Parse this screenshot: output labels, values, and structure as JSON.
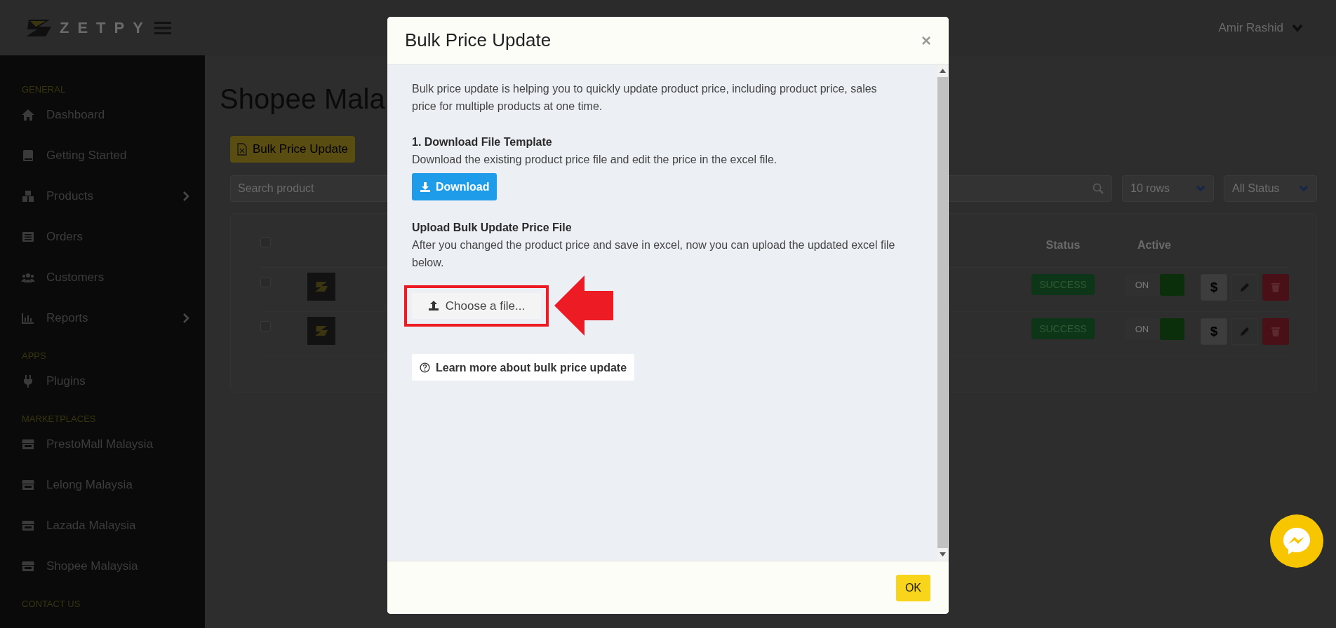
{
  "header": {
    "logo": "ZETPY",
    "user": "Amir Rashid"
  },
  "sidebar": {
    "sections": [
      {
        "label": "GENERAL",
        "items": [
          {
            "label": "Dashboard",
            "expandable": false
          },
          {
            "label": "Getting Started",
            "expandable": false
          },
          {
            "label": "Products",
            "expandable": true
          },
          {
            "label": "Orders",
            "expandable": false
          },
          {
            "label": "Customers",
            "expandable": false
          },
          {
            "label": "Reports",
            "expandable": true
          }
        ]
      },
      {
        "label": "APPS",
        "items": [
          {
            "label": "Plugins",
            "expandable": false
          }
        ]
      },
      {
        "label": "MARKETPLACES",
        "items": [
          {
            "label": "PrestoMall Malaysia",
            "expandable": false
          },
          {
            "label": "Lelong Malaysia",
            "expandable": false
          },
          {
            "label": "Lazada Malaysia",
            "expandable": false
          },
          {
            "label": "Shopee Malaysia",
            "expandable": false
          }
        ]
      },
      {
        "label": "CONTACT US"
      }
    ]
  },
  "page": {
    "title": "Shopee Mala",
    "toolbar_button": "Bulk Price Update",
    "search": {
      "placeholder": "Search product"
    },
    "rows_select": "10 rows",
    "status_select": "All Status"
  },
  "table": {
    "columns": [
      "Status",
      "Active"
    ],
    "header_checked": false,
    "rows": [
      {
        "checked": false,
        "status": "SUCCESS",
        "active": {
          "label": "ON",
          "on": true
        },
        "price_action": "$"
      },
      {
        "checked": false,
        "status": "SUCCESS",
        "active": {
          "label": "ON",
          "on": true
        },
        "price_action": "$"
      }
    ]
  },
  "modal": {
    "title": "Bulk Price Update",
    "close": "×",
    "intro": "Bulk price update is helping you to quickly update product price, including product price, sales price for multiple products at one time.",
    "steps": [
      {
        "kind": "download",
        "heading": "1. Download File Template",
        "text": "Download the existing product price file and edit the price in the excel file.",
        "button": "Download"
      },
      {
        "kind": "upload",
        "heading": "Upload Bulk Update Price File",
        "text": "After you changed the product price and save in excel, now you can upload the updated excel file below.",
        "button": "Choose a file..."
      }
    ],
    "learn_more": "Learn more about bulk price update",
    "ok": "OK"
  }
}
